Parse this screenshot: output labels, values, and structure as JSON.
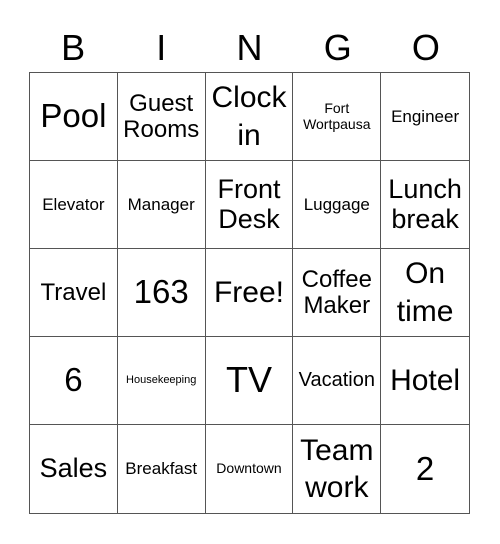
{
  "header": [
    "B",
    "I",
    "N",
    "G",
    "O"
  ],
  "cells": [
    {
      "text": "Pool",
      "size": "s30"
    },
    {
      "text": "Guest Rooms",
      "size": "s22"
    },
    {
      "text": "Clock in",
      "size": "s28"
    },
    {
      "text": "Fort Wortpausa",
      "size": "s13"
    },
    {
      "text": "Engineer",
      "size": "s16"
    },
    {
      "text": "Elevator",
      "size": "s16"
    },
    {
      "text": "Manager",
      "size": "s16"
    },
    {
      "text": "Front Desk",
      "size": "s26"
    },
    {
      "text": "Luggage",
      "size": "s16"
    },
    {
      "text": "Lunch break",
      "size": "s26"
    },
    {
      "text": "Travel",
      "size": "s22"
    },
    {
      "text": "163",
      "size": "s30"
    },
    {
      "text": "Free!",
      "size": "s28"
    },
    {
      "text": "Coffee Maker",
      "size": "s22"
    },
    {
      "text": "On time",
      "size": "s28"
    },
    {
      "text": "6",
      "size": "s30"
    },
    {
      "text": "Housekeeping",
      "size": "s11"
    },
    {
      "text": "TV",
      "size": "s34"
    },
    {
      "text": "Vacation",
      "size": "s19"
    },
    {
      "text": "Hotel",
      "size": "s28"
    },
    {
      "text": "Sales",
      "size": "s26"
    },
    {
      "text": "Breakfast",
      "size": "s16"
    },
    {
      "text": "Downtown",
      "size": "s13"
    },
    {
      "text": "Team work",
      "size": "s28"
    },
    {
      "text": "2",
      "size": "s30"
    }
  ]
}
